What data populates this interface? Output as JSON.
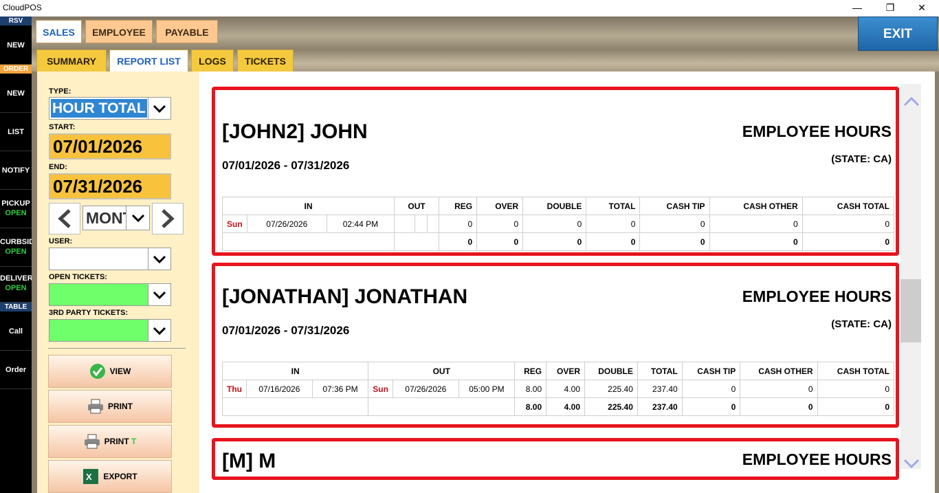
{
  "window": {
    "title": "CloudPOS"
  },
  "leftnav": {
    "headers": {
      "rsv": "RSV",
      "order": "ORDER",
      "table": "TABLE"
    },
    "items": [
      {
        "label": "NEW",
        "sub": ""
      },
      {
        "label": "NEW",
        "sub": ""
      },
      {
        "label": "LIST",
        "sub": ""
      },
      {
        "label": "NOTIFY",
        "sub": ""
      },
      {
        "label": "PICKUP",
        "sub": "OPEN"
      },
      {
        "label": "CURBSIDE",
        "sub": "OPEN"
      },
      {
        "label": "DELIVERY",
        "sub": "OPEN"
      },
      {
        "label": "Call",
        "sub": ""
      },
      {
        "label": "Order",
        "sub": ""
      }
    ]
  },
  "toptabs": [
    "SALES",
    "EMPLOYEE",
    "PAYABLE"
  ],
  "subtabs": [
    "SUMMARY",
    "REPORT LIST",
    "LOGS",
    "TICKETS"
  ],
  "exit_label": "EXIT",
  "filters": {
    "type_label": "TYPE:",
    "type_value": "HOUR TOTAL",
    "start_label": "START:",
    "start_value": "07/01/2026",
    "end_label": "END:",
    "end_value": "07/31/2026",
    "period_value": "MONTH",
    "user_label": "USER:",
    "open_tickets_label": "OPEN TICKETS:",
    "third_party_label": "3RD PARTY TICKETS:"
  },
  "actions": {
    "view": "VIEW",
    "print": "PRINT",
    "print_t": "PRINT",
    "print_t_suffix": "T",
    "export": "EXPORT"
  },
  "report": {
    "heading": "EMPLOYEE HOURS",
    "columns": {
      "in": "IN",
      "out": "OUT",
      "reg": "REG",
      "over": "OVER",
      "double": "DOUBLE",
      "total": "TOTAL",
      "cash_tip": "CASH TIP",
      "cash_other": "CASH OTHER",
      "cash_total": "CASH TOTAL"
    },
    "employees": [
      {
        "name": "[JOHN2] JOHN",
        "period": "07/01/2026 - 07/31/2026",
        "state": "(STATE: CA)",
        "row": {
          "in_day": "Sun",
          "in_date": "07/26/2026",
          "in_time": "02:44 PM",
          "reg": "0",
          "over": "0",
          "double": "0",
          "total": "0",
          "cash_tip": "0",
          "cash_other": "0",
          "cash_total": "0"
        },
        "totals": {
          "reg": "0",
          "over": "0",
          "double": "0",
          "total": "0",
          "cash_tip": "0",
          "cash_other": "0",
          "cash_total": "0"
        }
      },
      {
        "name": "[JONATHAN] JONATHAN",
        "period": "07/01/2026 - 07/31/2026",
        "state": "(STATE: CA)",
        "row": {
          "in_day": "Thu",
          "in_date": "07/16/2026",
          "in_time": "07:36 PM",
          "out_day": "Sun",
          "out_date": "07/26/2026",
          "out_time": "05:00 PM",
          "reg": "8.00",
          "over": "4.00",
          "double": "225.40",
          "total": "237.40",
          "cash_tip": "0",
          "cash_other": "0",
          "cash_total": "0"
        },
        "totals": {
          "reg": "8.00",
          "over": "4.00",
          "double": "225.40",
          "total": "237.40",
          "cash_tip": "0",
          "cash_other": "0",
          "cash_total": "0"
        }
      },
      {
        "name": "[M] M"
      }
    ]
  }
}
